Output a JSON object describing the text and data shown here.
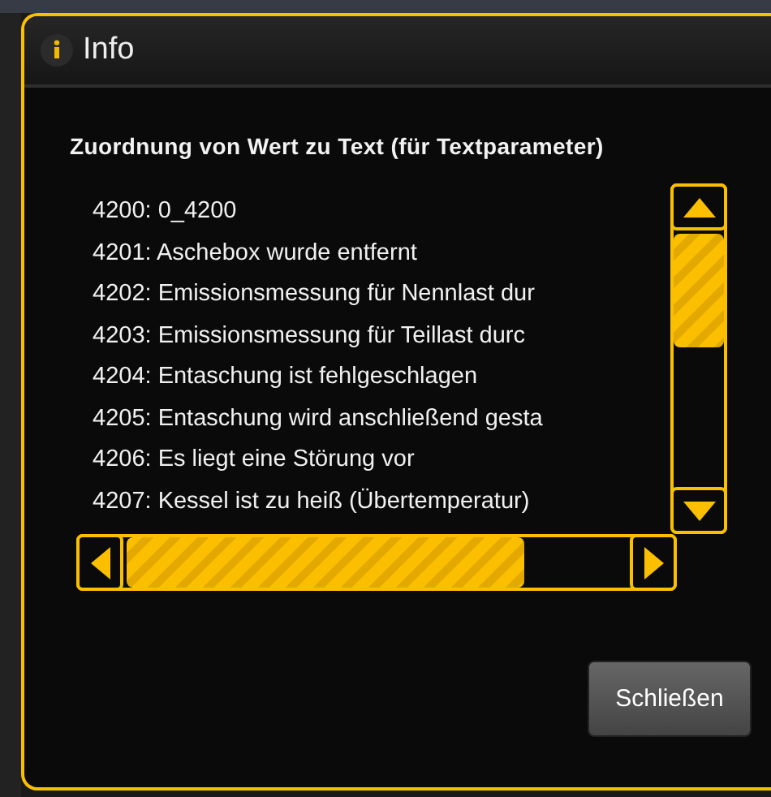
{
  "window": {
    "title": "Info"
  },
  "heading": "Zuordnung von Wert zu Text (für Textparameter)",
  "list": {
    "items": [
      "4200: 0_4200",
      "4201: Aschebox wurde entfernt",
      "4202: Emissionsmessung für Nennlast dur",
      "4203: Emissionsmessung für Teillast durc",
      "4204: Entaschung ist fehlgeschlagen",
      "4205: Entaschung wird anschließend gesta",
      "4206: Es liegt eine Störung vor",
      "4207: Kessel ist zu heiß (Übertemperatur)"
    ]
  },
  "buttons": [
    {
      "label": "Schließen"
    }
  ]
}
